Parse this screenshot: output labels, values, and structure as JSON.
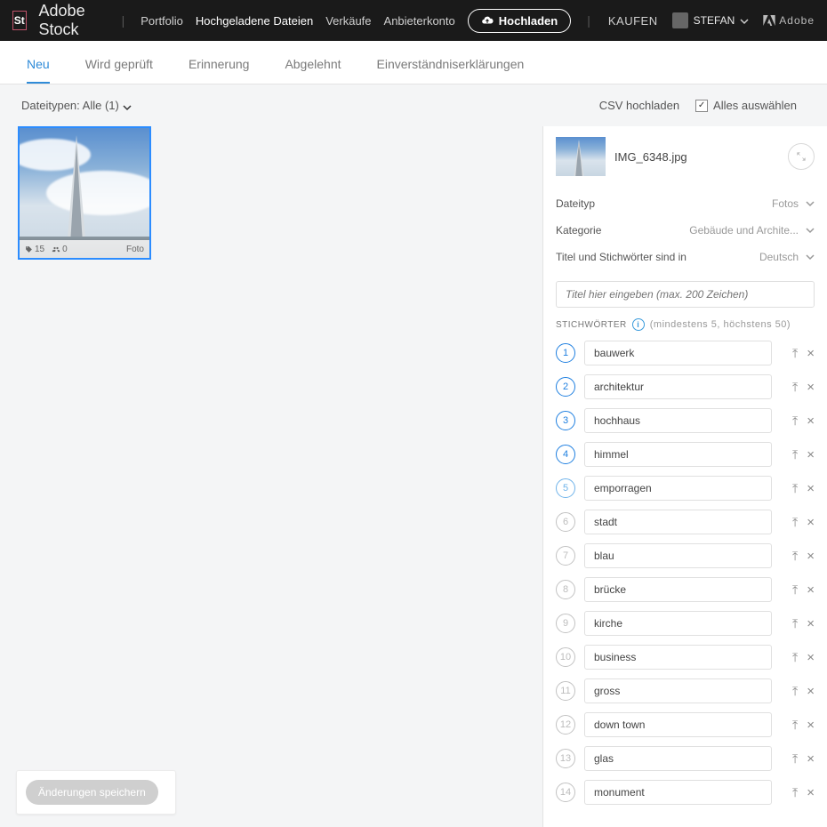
{
  "brand": "Adobe Stock",
  "brand_short": "St",
  "adobe_label": "Adobe",
  "nav": {
    "portfolio": "Portfolio",
    "uploaded": "Hochgeladene Dateien",
    "sales": "Verkäufe",
    "account": "Anbieterkonto",
    "upload": "Hochladen",
    "buy": "KAUFEN",
    "user": "STEFAN"
  },
  "tabs": {
    "new": "Neu",
    "reviewing": "Wird geprüft",
    "reminder": "Erinnerung",
    "rejected": "Abgelehnt",
    "consent": "Einverständniserklärungen"
  },
  "toolbar": {
    "filetypes": "Dateitypen: Alle (1)",
    "csv": "CSV hochladen",
    "selectall": "Alles auswählen",
    "selectall_checked": true
  },
  "thumb": {
    "tags": "15",
    "people": "0",
    "type": "Foto"
  },
  "detail": {
    "filename": "IMG_6348.jpg",
    "rows": {
      "filetype_label": "Dateityp",
      "filetype_value": "Fotos",
      "category_label": "Kategorie",
      "category_value": "Gebäude und Archite...",
      "lang_label": "Titel und Stichwörter sind in",
      "lang_value": "Deutsch"
    },
    "title_placeholder": "Titel hier eingeben (max. 200 Zeichen)",
    "kw_label": "STICHWÖRTER",
    "kw_hint": "(mindestens 5, höchstens 50)"
  },
  "keywords": [
    "bauwerk",
    "architektur",
    "hochhaus",
    "himmel",
    "emporragen",
    "stadt",
    "blau",
    "brücke",
    "kirche",
    "business",
    "gross",
    "down town",
    "glas",
    "monument"
  ],
  "save_label": "Änderungen speichern"
}
